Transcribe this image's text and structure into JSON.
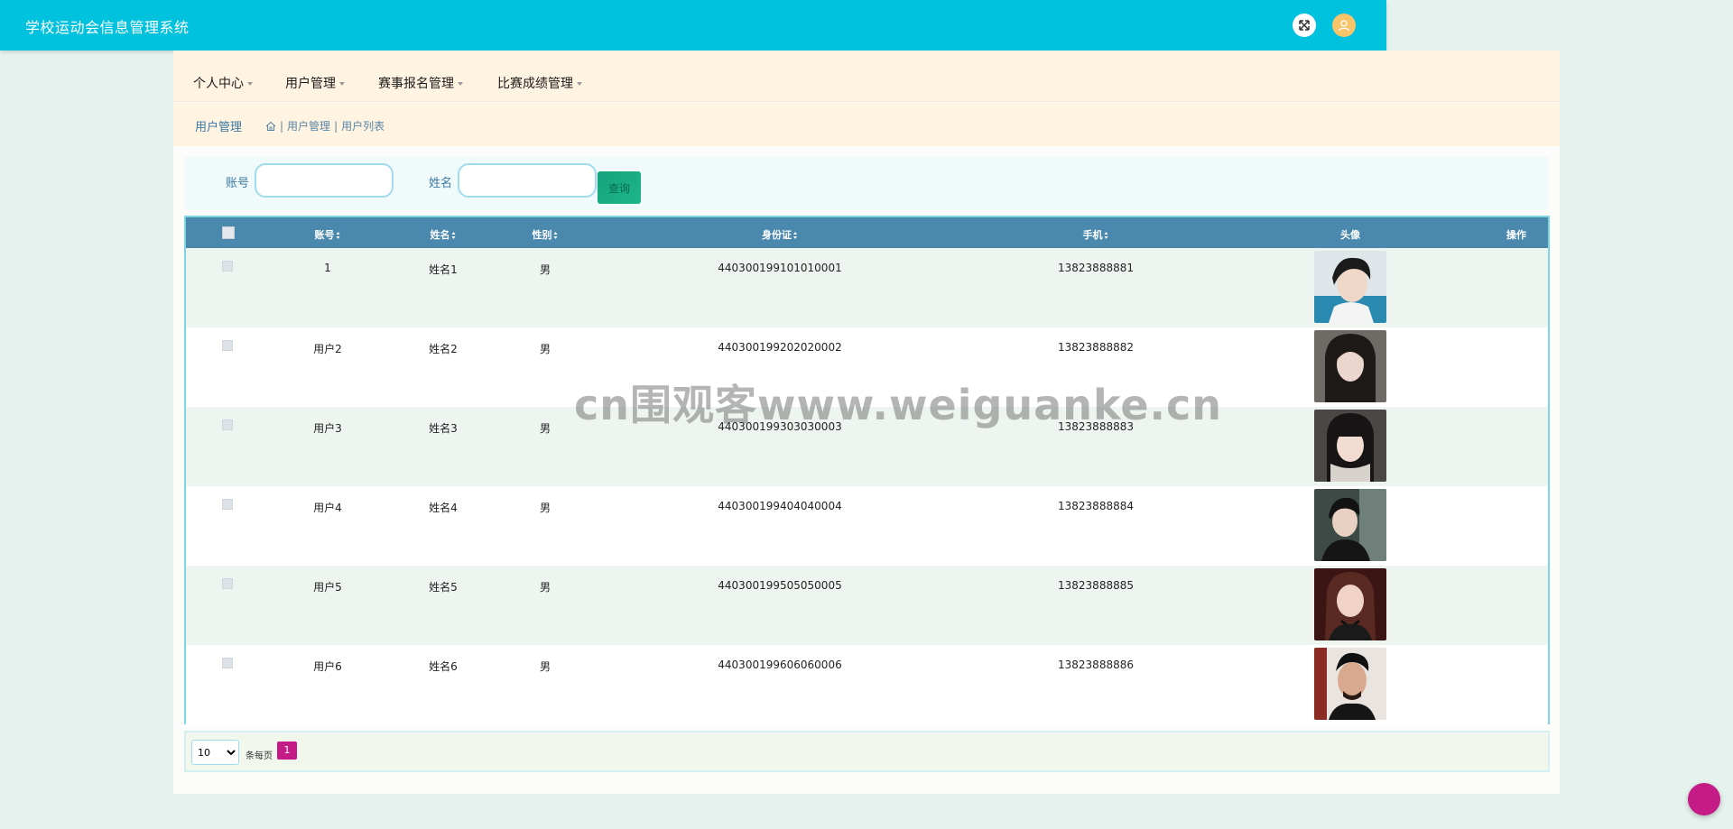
{
  "header": {
    "app_title": "学校运动会信息管理系统"
  },
  "nav": {
    "items": [
      {
        "label": "个人中心"
      },
      {
        "label": "用户管理"
      },
      {
        "label": "赛事报名管理"
      },
      {
        "label": "比赛成绩管理"
      }
    ]
  },
  "breadcrumb": {
    "title": "用户管理",
    "path": [
      "用户管理",
      "用户列表"
    ]
  },
  "search": {
    "account_label": "账号",
    "account_value": "",
    "name_label": "姓名",
    "name_value": "",
    "button_label": "查询"
  },
  "table": {
    "columns": [
      "账号",
      "姓名",
      "性别",
      "身份证",
      "手机",
      "头像",
      "操作"
    ],
    "rows": [
      {
        "account": "1",
        "name": "姓名1",
        "gender": "男",
        "id_card": "440300199101010001",
        "phone": "13823888881"
      },
      {
        "account": "用户2",
        "name": "姓名2",
        "gender": "男",
        "id_card": "440300199202020002",
        "phone": "13823888882"
      },
      {
        "account": "用户3",
        "name": "姓名3",
        "gender": "男",
        "id_card": "440300199303030003",
        "phone": "13823888883"
      },
      {
        "account": "用户4",
        "name": "姓名4",
        "gender": "男",
        "id_card": "440300199404040004",
        "phone": "13823888884"
      },
      {
        "account": "用户5",
        "name": "姓名5",
        "gender": "男",
        "id_card": "440300199505050005",
        "phone": "13823888885"
      },
      {
        "account": "用户6",
        "name": "姓名6",
        "gender": "男",
        "id_card": "440300199606060006",
        "phone": "13823888886"
      }
    ]
  },
  "pagination": {
    "page_size": "10",
    "page_size_options": [
      "10"
    ],
    "per_page_text": "条每页",
    "current_page": "1"
  },
  "watermark": "cn围观客www.weiguanke.cn",
  "colors": {
    "topbar": "#00c1de",
    "table_header": "#4a89ad",
    "accent": "#c41b86",
    "search_button": "#14a27c"
  },
  "icons": {
    "fullscreen": "expand-arrows-icon",
    "avatar": "user-icon",
    "home": "home-icon"
  }
}
